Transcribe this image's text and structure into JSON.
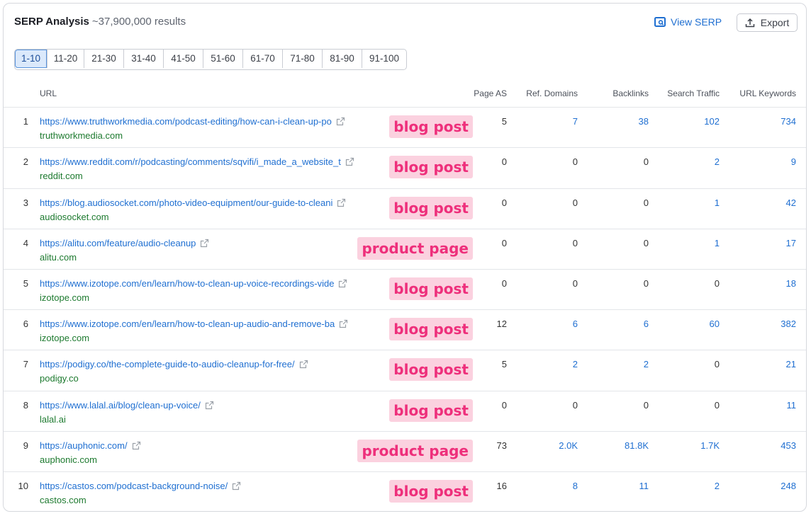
{
  "header": {
    "title": "SERP Analysis",
    "results": "~37,900,000 results",
    "view_serp": "View SERP",
    "export": "Export"
  },
  "pagination": [
    "1-10",
    "11-20",
    "21-30",
    "31-40",
    "41-50",
    "51-60",
    "61-70",
    "71-80",
    "81-90",
    "91-100"
  ],
  "pagination_active": "1-10",
  "columns": {
    "url": "URL",
    "page_as": "Page AS",
    "ref_domains": "Ref. Domains",
    "backlinks": "Backlinks",
    "search_traffic": "Search Traffic",
    "url_keywords": "URL Keywords"
  },
  "rows": [
    {
      "num": "1",
      "url": "https://www.truthworkmedia.com/podcast-editing/how-can-i-clean-up-po",
      "domain": "truthworkmedia.com",
      "tag": "blog post",
      "page_as": "5",
      "ref_domains": "7",
      "backlinks": "38",
      "search_traffic": "102",
      "url_keywords": "734"
    },
    {
      "num": "2",
      "url": "https://www.reddit.com/r/podcasting/comments/sqvifi/i_made_a_website_t",
      "domain": "reddit.com",
      "tag": "blog post",
      "page_as": "0",
      "ref_domains": "0",
      "backlinks": "0",
      "search_traffic": "2",
      "url_keywords": "9"
    },
    {
      "num": "3",
      "url": "https://blog.audiosocket.com/photo-video-equipment/our-guide-to-cleani",
      "domain": "audiosocket.com",
      "tag": "blog post",
      "page_as": "0",
      "ref_domains": "0",
      "backlinks": "0",
      "search_traffic": "1",
      "url_keywords": "42"
    },
    {
      "num": "4",
      "url": "https://alitu.com/feature/audio-cleanup",
      "domain": "alitu.com",
      "tag": "product page",
      "page_as": "0",
      "ref_domains": "0",
      "backlinks": "0",
      "search_traffic": "1",
      "url_keywords": "17"
    },
    {
      "num": "5",
      "url": "https://www.izotope.com/en/learn/how-to-clean-up-voice-recordings-vide",
      "domain": "izotope.com",
      "tag": "blog post",
      "page_as": "0",
      "ref_domains": "0",
      "backlinks": "0",
      "search_traffic": "0",
      "url_keywords": "18"
    },
    {
      "num": "6",
      "url": "https://www.izotope.com/en/learn/how-to-clean-up-audio-and-remove-ba",
      "domain": "izotope.com",
      "tag": "blog post",
      "page_as": "12",
      "ref_domains": "6",
      "backlinks": "6",
      "search_traffic": "60",
      "url_keywords": "382"
    },
    {
      "num": "7",
      "url": "https://podigy.co/the-complete-guide-to-audio-cleanup-for-free/",
      "domain": "podigy.co",
      "tag": "blog post",
      "page_as": "5",
      "ref_domains": "2",
      "backlinks": "2",
      "search_traffic": "0",
      "url_keywords": "21"
    },
    {
      "num": "8",
      "url": "https://www.lalal.ai/blog/clean-up-voice/",
      "domain": "lalal.ai",
      "tag": "blog post",
      "page_as": "0",
      "ref_domains": "0",
      "backlinks": "0",
      "search_traffic": "0",
      "url_keywords": "11"
    },
    {
      "num": "9",
      "url": "https://auphonic.com/",
      "domain": "auphonic.com",
      "tag": "product page",
      "page_as": "73",
      "ref_domains": "2.0K",
      "backlinks": "81.8K",
      "search_traffic": "1.7K",
      "url_keywords": "453"
    },
    {
      "num": "10",
      "url": "https://castos.com/podcast-background-noise/",
      "domain": "castos.com",
      "tag": "blog post",
      "page_as": "16",
      "ref_domains": "8",
      "backlinks": "11",
      "search_traffic": "2",
      "url_keywords": "248"
    }
  ],
  "colors": {
    "link": "#1f6fd1",
    "domain": "#1d7a2f",
    "tag_bg": "#fbd1df",
    "tag_text": "#ee2f7b"
  }
}
